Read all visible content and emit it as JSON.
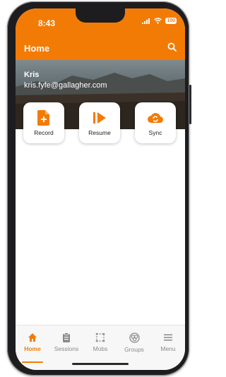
{
  "status_bar": {
    "time": "8:43",
    "battery": "100"
  },
  "header": {
    "title": "Home"
  },
  "user": {
    "name": "Kris",
    "email": "kris.fyfe@gallagher.com"
  },
  "actions": [
    {
      "label": "Record",
      "icon": "add-document-icon"
    },
    {
      "label": "Resume",
      "icon": "resume-icon"
    },
    {
      "label": "Sync",
      "icon": "cloud-sync-icon"
    }
  ],
  "tabs": [
    {
      "label": "Home",
      "icon": "home-icon",
      "active": true
    },
    {
      "label": "Sessions",
      "icon": "clipboard-icon",
      "active": false
    },
    {
      "label": "Mobs",
      "icon": "mobs-icon",
      "active": false
    },
    {
      "label": "Groups",
      "icon": "groups-icon",
      "active": false
    },
    {
      "label": "Menu",
      "icon": "menu-icon",
      "active": false
    }
  ],
  "colors": {
    "accent": "#f27b06",
    "inactive": "#8a8a8a"
  }
}
